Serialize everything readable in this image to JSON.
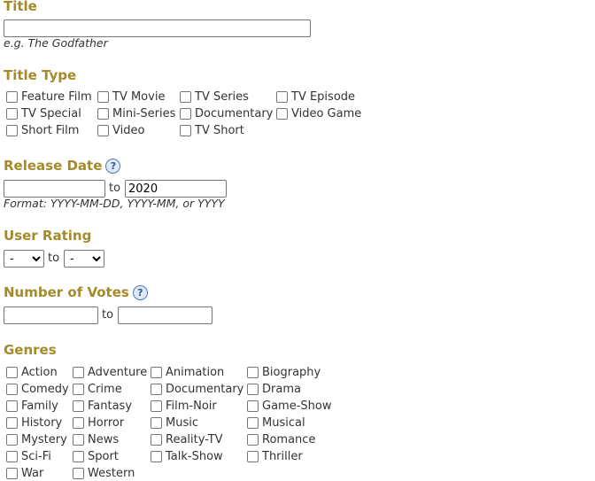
{
  "title_section": {
    "heading": "Title",
    "input_value": "",
    "hint": "e.g. The Godfather"
  },
  "title_type": {
    "heading": "Title Type",
    "options": [
      {
        "label": "Feature Film",
        "checked": false
      },
      {
        "label": "TV Movie",
        "checked": false
      },
      {
        "label": "TV Series",
        "checked": false
      },
      {
        "label": "TV Episode",
        "checked": false
      },
      {
        "label": "TV Special",
        "checked": false
      },
      {
        "label": "Mini-Series",
        "checked": false
      },
      {
        "label": "Documentary",
        "checked": false
      },
      {
        "label": "Video Game",
        "checked": false
      },
      {
        "label": "Short Film",
        "checked": false
      },
      {
        "label": "Video",
        "checked": false
      },
      {
        "label": "TV Short",
        "checked": false
      }
    ]
  },
  "release_date": {
    "heading": "Release Date",
    "help_icon": "?",
    "from_value": "",
    "to_label": "to",
    "to_value": "2020",
    "hint": "Format: YYYY-MM-DD, YYYY-MM, or YYYY"
  },
  "user_rating": {
    "heading": "User Rating",
    "from_selected": "-",
    "to_label": "to",
    "to_selected": "-"
  },
  "num_votes": {
    "heading": "Number of Votes",
    "help_icon": "?",
    "from_value": "",
    "to_label": "to",
    "to_value": ""
  },
  "genres": {
    "heading": "Genres",
    "options": [
      {
        "label": "Action",
        "checked": false
      },
      {
        "label": "Adventure",
        "checked": false
      },
      {
        "label": "Animation",
        "checked": false
      },
      {
        "label": "Biography",
        "checked": false
      },
      {
        "label": "Comedy",
        "checked": false
      },
      {
        "label": "Crime",
        "checked": false
      },
      {
        "label": "Documentary",
        "checked": false
      },
      {
        "label": "Drama",
        "checked": false
      },
      {
        "label": "Family",
        "checked": false
      },
      {
        "label": "Fantasy",
        "checked": false
      },
      {
        "label": "Film-Noir",
        "checked": false
      },
      {
        "label": "Game-Show",
        "checked": false
      },
      {
        "label": "History",
        "checked": false
      },
      {
        "label": "Horror",
        "checked": false
      },
      {
        "label": "Music",
        "checked": false
      },
      {
        "label": "Musical",
        "checked": false
      },
      {
        "label": "Mystery",
        "checked": false
      },
      {
        "label": "News",
        "checked": false
      },
      {
        "label": "Reality-TV",
        "checked": false
      },
      {
        "label": "Romance",
        "checked": false
      },
      {
        "label": "Sci-Fi",
        "checked": false
      },
      {
        "label": "Sport",
        "checked": false
      },
      {
        "label": "Talk-Show",
        "checked": false
      },
      {
        "label": "Thriller",
        "checked": false
      },
      {
        "label": "War",
        "checked": false
      },
      {
        "label": "Western",
        "checked": false
      }
    ]
  }
}
